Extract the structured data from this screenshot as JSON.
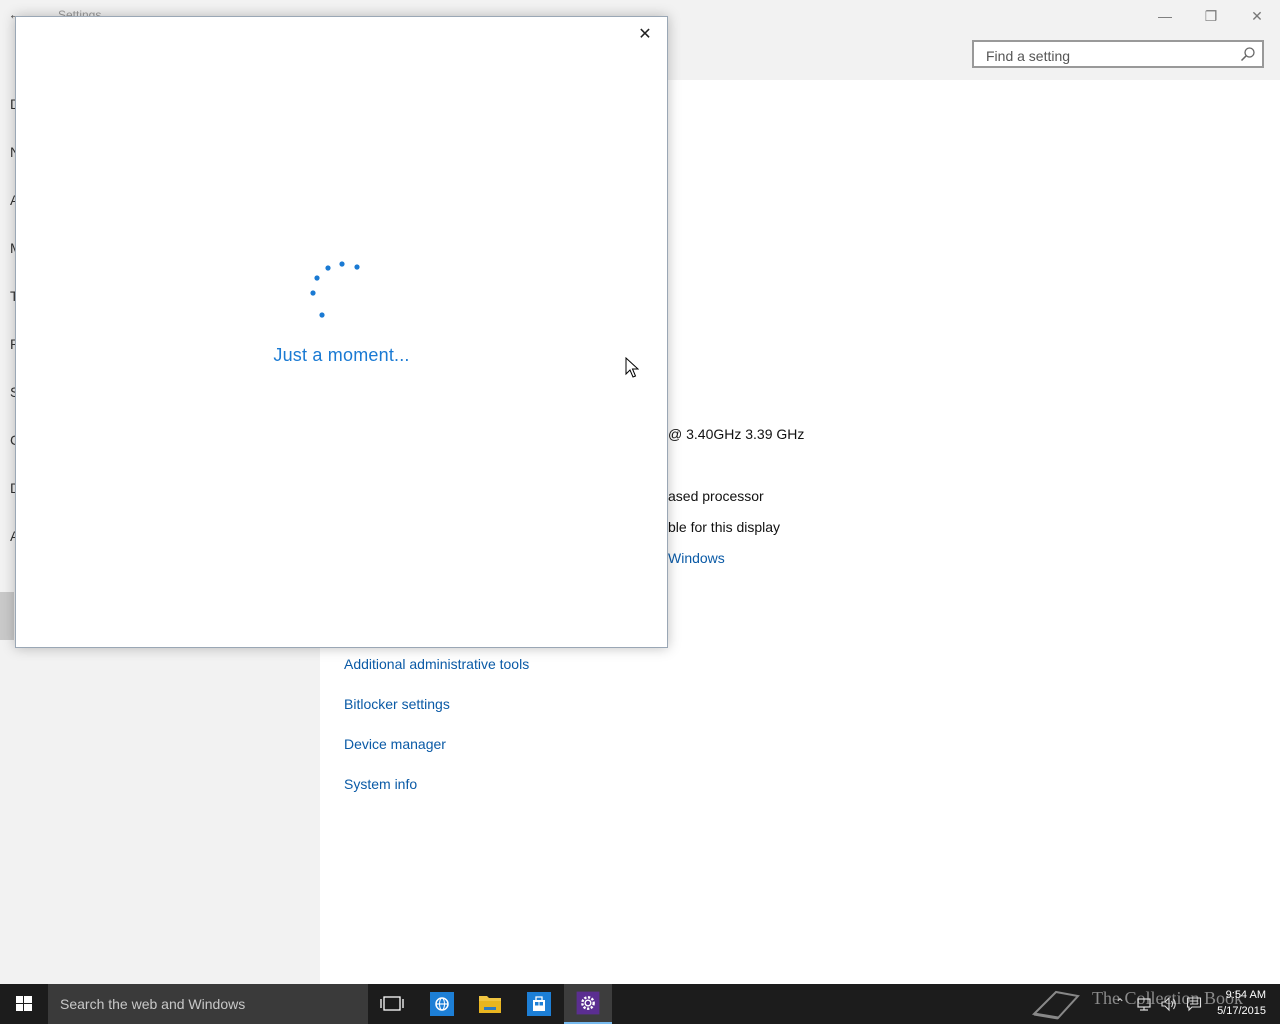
{
  "settings_window": {
    "back_icon": "back-arrow-icon",
    "title": "Settings",
    "controls": {
      "minimize": "—",
      "restore": "❐",
      "close": "✕"
    },
    "search": {
      "placeholder": "Find a setting",
      "icon": "search-icon"
    },
    "nav_fragments": [
      "D",
      "N",
      "A",
      "M",
      "T",
      "P",
      "S",
      "C",
      "D",
      "A"
    ],
    "about_fragments": {
      "processor_speed": "@ 3.40GHz   3.39 GHz",
      "system_type": "ased processor",
      "pen_touch": "ble for this display",
      "windows_link": "Windows"
    },
    "related_links": [
      "Additional administrative tools",
      "Bitlocker settings",
      "Device manager",
      "System info"
    ]
  },
  "dialog": {
    "close_label": "✕",
    "loading_text": "Just a moment...",
    "spinner_icon": "loading-spinner-icon"
  },
  "taskbar": {
    "search_placeholder": "Search the web and Windows",
    "pinned": [
      "task-view-icon",
      "internet-explorer-icon",
      "file-explorer-icon",
      "store-icon",
      "settings-gear-icon"
    ],
    "watermark": "The Collection Book",
    "clock_time": "9:54 AM",
    "clock_date": "5/17/2015"
  },
  "colors": {
    "accent": "#1a7ad3",
    "link": "#0a5aa6",
    "taskbar": "#1c1c1c",
    "nav_bg": "#f2f2f2"
  }
}
